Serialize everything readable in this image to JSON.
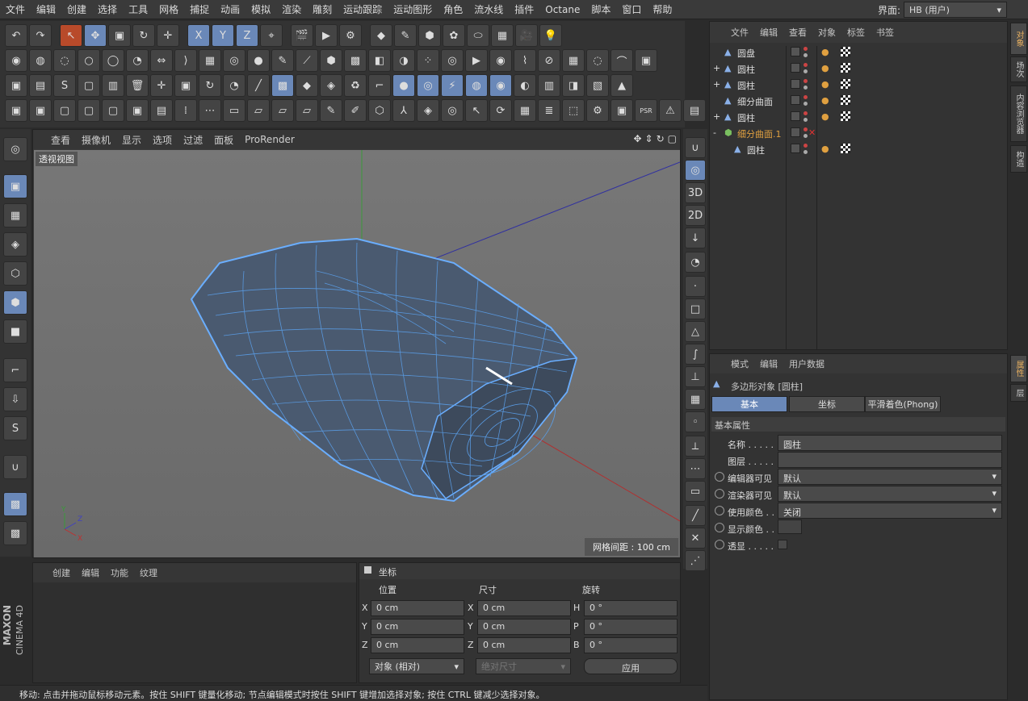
{
  "menubar": {
    "items": [
      "文件",
      "编辑",
      "创建",
      "选择",
      "工具",
      "网格",
      "捕捉",
      "动画",
      "模拟",
      "渲染",
      "雕刻",
      "运动跟踪",
      "运动图形",
      "角色",
      "流水线",
      "插件",
      "Octane",
      "脚本",
      "窗口",
      "帮助"
    ],
    "interface_label": "界面:",
    "interface_value": "HB (用户)"
  },
  "viewport": {
    "menu": [
      "查看",
      "摄像机",
      "显示",
      "选项",
      "过滤",
      "面板",
      "ProRender"
    ],
    "label": "透视视图",
    "grid_info": "网格间距 : 100 cm"
  },
  "material_panel": {
    "menu": [
      "创建",
      "编辑",
      "功能",
      "纹理"
    ]
  },
  "coords": {
    "title": "坐标",
    "col_position": "位置",
    "col_size": "尺寸",
    "col_rotation": "旋转",
    "rows": [
      {
        "axis": "X",
        "pos": "0 cm",
        "size_axis": "X",
        "size": "0 cm",
        "rot_axis": "H",
        "rot": "0 °"
      },
      {
        "axis": "Y",
        "pos": "0 cm",
        "size_axis": "Y",
        "size": "0 cm",
        "rot_axis": "P",
        "rot": "0 °"
      },
      {
        "axis": "Z",
        "pos": "0 cm",
        "size_axis": "Z",
        "size": "0 cm",
        "rot_axis": "B",
        "rot": "0 °"
      }
    ],
    "mode": "对象 (相对)",
    "size_mode": "绝对尺寸",
    "apply": "应用"
  },
  "status": "移动: 点击并拖动鼠标移动元素。按住 SHIFT 键量化移动; 节点编辑模式时按住 SHIFT 键增加选择对象; 按住 CTRL 键减少选择对象。",
  "object_manager": {
    "menu": [
      "文件",
      "编辑",
      "查看",
      "对象",
      "标签",
      "书签"
    ],
    "objects": [
      {
        "name": "圆盘",
        "indent": 0,
        "expand": ""
      },
      {
        "name": "圆柱",
        "indent": 0,
        "expand": "+"
      },
      {
        "name": "圆柱",
        "indent": 0,
        "expand": "+"
      },
      {
        "name": "细分曲面",
        "indent": 0,
        "expand": ""
      },
      {
        "name": "圆柱",
        "indent": 0,
        "expand": "+"
      },
      {
        "name": "细分曲面.1",
        "indent": 0,
        "expand": "-"
      },
      {
        "name": "圆柱",
        "indent": 1,
        "expand": ""
      }
    ]
  },
  "attributes": {
    "menu": [
      "模式",
      "编辑",
      "用户数据"
    ],
    "title": "多边形对象 [圆柱]",
    "tabs": [
      "基本",
      "坐标",
      "平滑着色(Phong)"
    ],
    "section": "基本属性",
    "fields": [
      {
        "label": "名称 . . . . .",
        "value": "圆柱"
      },
      {
        "label": "图层 . . . . .",
        "value": ""
      },
      {
        "label": "编辑器可见",
        "value": "默认"
      },
      {
        "label": "渲染器可见",
        "value": "默认"
      },
      {
        "label": "使用颜色 . .",
        "value": "关闭"
      },
      {
        "label": "显示颜色 . .",
        "value": ""
      },
      {
        "label": "透显 . . . . .",
        "value": ""
      }
    ]
  },
  "side_tabs_top": [
    "对象",
    "场次",
    "内容浏览器",
    "构造"
  ],
  "side_tabs_bottom": [
    "属性",
    "层"
  ],
  "brand": {
    "line1": "MAXON",
    "line2": "CINEMA 4D"
  },
  "colors": {
    "accent": "#6a88b8",
    "panel": "#333333",
    "mesh_edge": "#5a9ee8"
  }
}
